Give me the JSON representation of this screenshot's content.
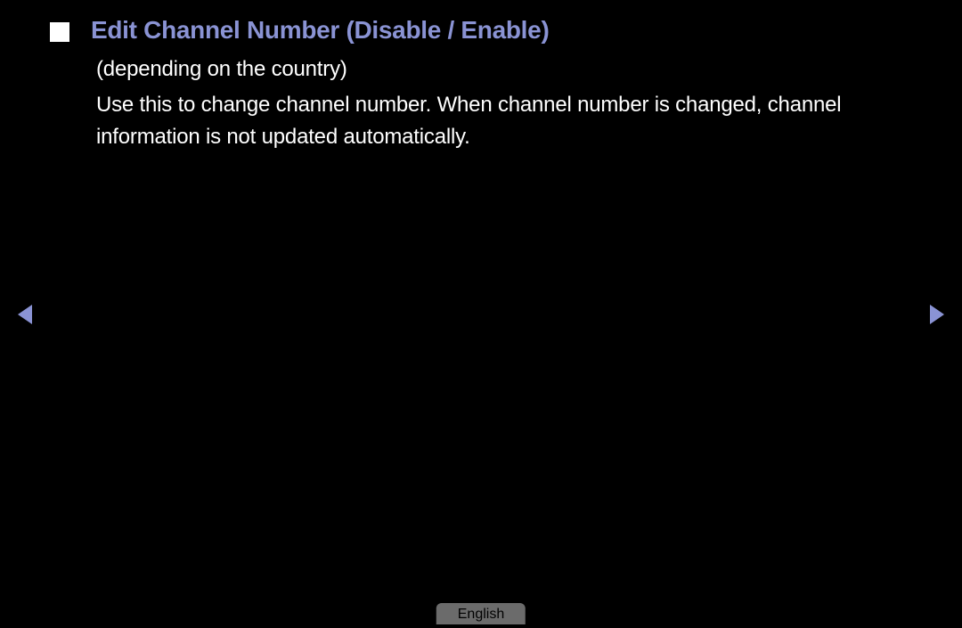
{
  "title": "Edit Channel Number (Disable / Enable)",
  "subtitle": "(depending on the country)",
  "description": "Use this to change channel number. When channel number is changed, channel information is not updated automatically.",
  "language": "English",
  "colors": {
    "titleColor": "#8a93d4",
    "arrowColor": "#8a93d4",
    "background": "#000000",
    "text": "#ffffff"
  }
}
